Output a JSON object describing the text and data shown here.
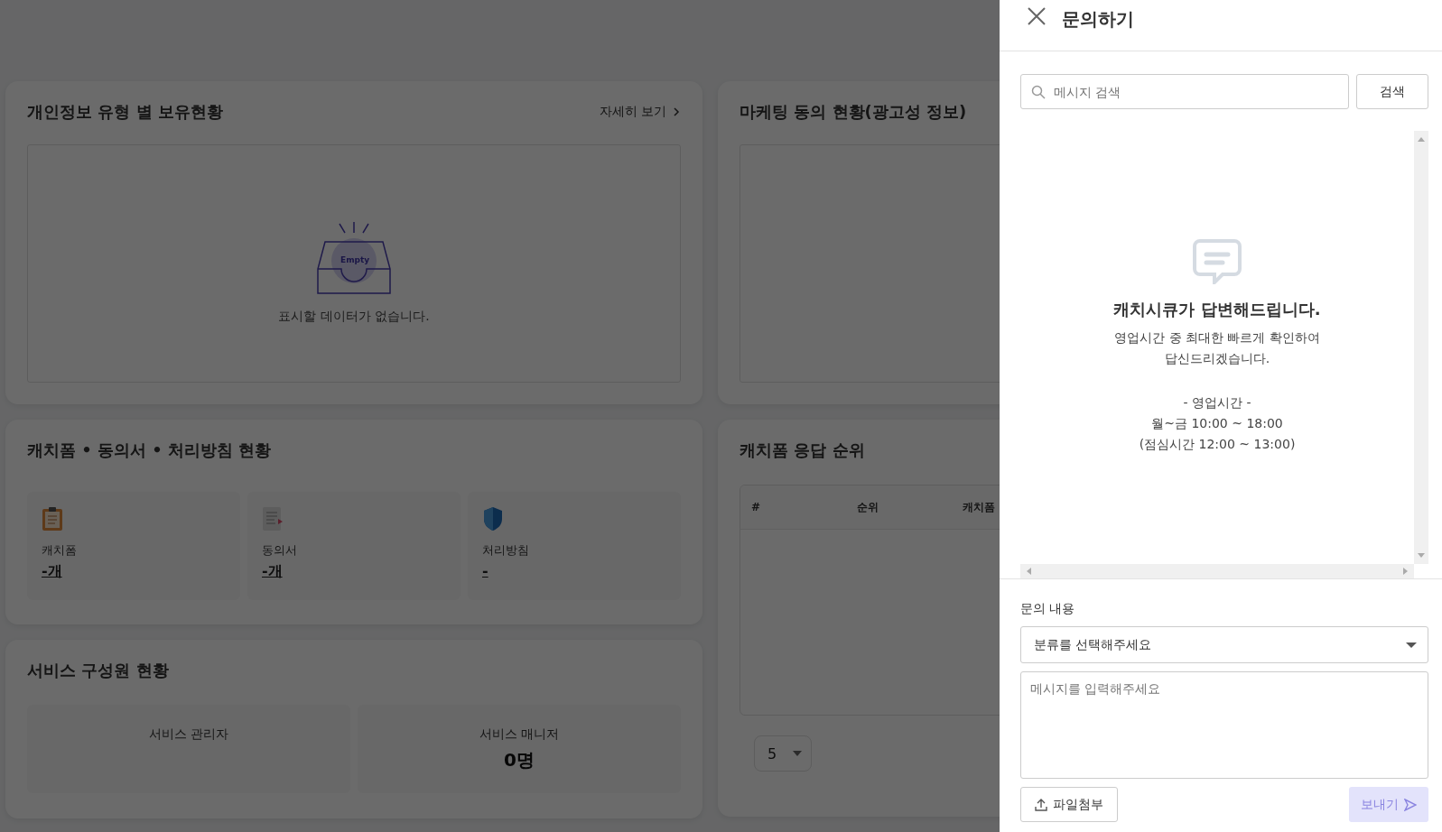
{
  "dashboard": {
    "privacy_card": {
      "title": "개인정보 유형 별 보유현황",
      "more_link": "자세히 보기",
      "empty_badge": "Empty",
      "empty_text": "표시할 데이터가 없습니다."
    },
    "marketing_card": {
      "title": "마케팅 동의 현황(광고성 정보)"
    },
    "documents_card": {
      "title": "캐치폼 • 동의서 • 처리방침 현황",
      "items": [
        {
          "kind": "clipboard",
          "label": "캐치폼",
          "value": "-개"
        },
        {
          "kind": "document",
          "label": "동의서",
          "value": "-개"
        },
        {
          "kind": "shield",
          "label": "처리방침",
          "value": "-"
        }
      ]
    },
    "members_card": {
      "title": "서비스 구성원 현황",
      "items": [
        {
          "label": "서비스 관리자"
        },
        {
          "label": "서비스 매니저",
          "value": "0명"
        }
      ]
    },
    "ranking_card": {
      "title": "캐치폼 응답 순위",
      "columns": [
        "#",
        "순위",
        "캐치폼"
      ],
      "page_size": "5"
    }
  },
  "drawer": {
    "title": "문의하기",
    "search": {
      "placeholder": "메시지 검색",
      "button": "검색"
    },
    "intro": {
      "heading": "캐치시큐가 답변해드립니다.",
      "message": [
        "영업시간 중 최대한 빠르게 확인하여",
        "답신드리겠습니다."
      ],
      "hours": [
        "- 영업시간 -",
        "월~금 10:00 ~ 18:00",
        "(점심시간 12:00 ~ 13:00)"
      ]
    },
    "form": {
      "label": "문의 내용",
      "category_placeholder": "분류를 선택해주세요",
      "message_placeholder": "메시지를 입력해주세요",
      "attach_button": "파일첨부",
      "send_button": {
        "label": "보내기",
        "disabled": true
      }
    }
  }
}
